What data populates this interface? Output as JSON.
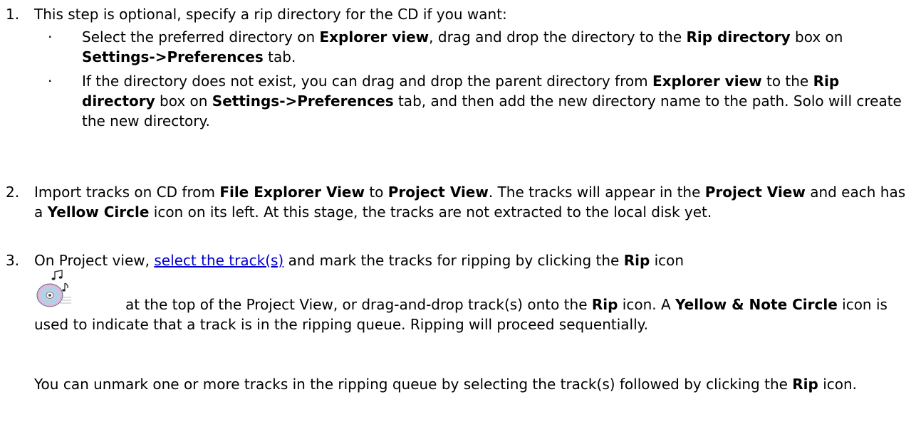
{
  "steps": [
    {
      "number": "1.",
      "intro": "This step is optional, specify a rip directory for the CD if you want:",
      "bullets": [
        {
          "marker": "·",
          "parts": [
            "Select the preferred directory on ",
            "Explorer view",
            ", drag and drop the directory to the ",
            "Rip directory",
            " box on ",
            "Settings->Preferences",
            " tab."
          ]
        },
        {
          "marker": "·",
          "parts": [
            "If the directory does not exist, you can drag and drop the parent directory from ",
            "Explorer view",
            " to the ",
            "Rip directory",
            " box on ",
            "Settings->Preferences",
            " tab, and then add the new directory name to the path. Solo will create the new directory."
          ]
        }
      ]
    },
    {
      "number": "2.",
      "parts": [
        "Import tracks on CD from ",
        "File Explorer View",
        " to ",
        "Project View",
        ". The tracks will appear in the ",
        "Project View",
        " and each has a ",
        "Yellow Circle",
        " icon on its left. At this stage, the tracks are not extracted to the local disk yet."
      ]
    },
    {
      "number": "3.",
      "lead": "On Project view, ",
      "link": "select the track(s)",
      "after_link": " and mark the tracks for ripping by clicking the ",
      "rip": "Rip",
      "icon_word": " icon",
      "after_icon_parts": [
        "at the top of the Project View, or drag-and-drop track(s) onto the ",
        "Rip",
        " icon. A ",
        "Yellow & Note Circle",
        " icon is used to indicate that a track is in the ripping queue. Ripping will proceed sequentially."
      ],
      "para2_parts": [
        "You can unmark one or more tracks in the ripping queue by selecting the track(s) followed by clicking the ",
        "Rip",
        " icon."
      ]
    }
  ]
}
